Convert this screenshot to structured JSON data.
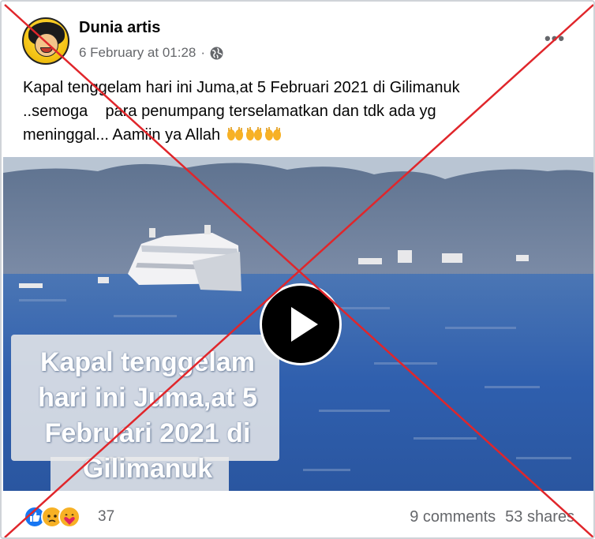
{
  "post": {
    "author": "Dunia artis",
    "timestamp": "6 February at 01:28",
    "separator": "·",
    "audience_icon": "globe-icon",
    "more_icon": "more-options-icon",
    "caption_line1": "Kapal tenggelam hari ini Juma,at 5 Februari 2021 di Gilimanuk",
    "caption_line2": "..semoga    para penumpang terselamatkan dan tdk ada yg",
    "caption_line3": "meninggal... Aamiin ya Allah",
    "caption_emoji": [
      "open-hands-emoji",
      "open-hands-emoji",
      "open-hands-emoji"
    ]
  },
  "video": {
    "overlay_text": "Kapal tenggelam\nhari ini Juma,at 5\nFebruari 2021 di\nGilimanuk",
    "play_icon": "play-icon"
  },
  "footer": {
    "reactions": [
      "like-reaction-icon",
      "sad-reaction-icon",
      "care-reaction-icon"
    ],
    "reaction_count": "37",
    "comments": "9 comments",
    "shares": "53 shares"
  },
  "colors": {
    "cross": "#e0262b",
    "like": "#1877f2",
    "secondary_text": "#65676b",
    "sea": "#2e5fa8"
  }
}
